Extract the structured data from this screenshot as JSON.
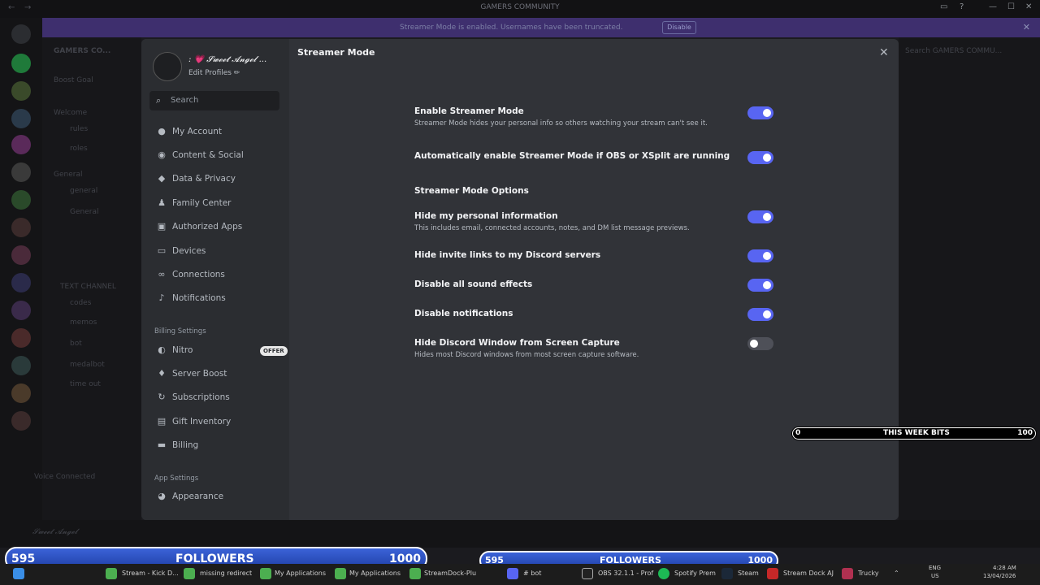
{
  "window": {
    "title": "GAMERS COMMUNITY"
  },
  "banner": {
    "message": "Streamer Mode is enabled. Usernames have been truncated.",
    "disable_label": "Disable"
  },
  "profile": {
    "name": ": 💗 𝓢𝔀𝓮𝓮𝓽 𝓐𝓷𝓰𝓮𝓵 ...",
    "edit_label": "Edit Profiles ✏"
  },
  "search": {
    "placeholder": "Search"
  },
  "sidebar": {
    "user_items": [
      {
        "label": "My Account",
        "icon": "person-icon"
      },
      {
        "label": "Content & Social",
        "icon": "content-icon"
      },
      {
        "label": "Data & Privacy",
        "icon": "shield-icon"
      },
      {
        "label": "Family Center",
        "icon": "family-icon"
      },
      {
        "label": "Authorized Apps",
        "icon": "apps-icon"
      },
      {
        "label": "Devices",
        "icon": "devices-icon"
      },
      {
        "label": "Connections",
        "icon": "link-icon"
      },
      {
        "label": "Notifications",
        "icon": "bell-icon"
      }
    ],
    "billing_header": "Billing Settings",
    "billing_items": [
      {
        "label": "Nitro",
        "icon": "nitro-icon",
        "badge": "OFFER"
      },
      {
        "label": "Server Boost",
        "icon": "boost-icon"
      },
      {
        "label": "Subscriptions",
        "icon": "refresh-icon"
      },
      {
        "label": "Gift Inventory",
        "icon": "gift-icon"
      },
      {
        "label": "Billing",
        "icon": "card-icon"
      }
    ],
    "app_header": "App Settings",
    "app_items": [
      {
        "label": "Appearance",
        "icon": "palette-icon"
      }
    ]
  },
  "content": {
    "title": "Streamer Mode",
    "enable": {
      "title": "Enable Streamer Mode",
      "desc": "Streamer Mode hides your personal info so others watching your stream can't see it.",
      "on": true
    },
    "auto": {
      "title": "Automatically enable Streamer Mode if OBS or XSplit are running",
      "on": true
    },
    "options_header": "Streamer Mode Options",
    "options": [
      {
        "title": "Hide my personal information",
        "desc": "This includes email, connected accounts, notes, and DM list message previews.",
        "on": true
      },
      {
        "title": "Hide invite links to my Discord servers",
        "desc": "",
        "on": true
      },
      {
        "title": "Disable all sound effects",
        "desc": "",
        "on": true
      },
      {
        "title": "Disable notifications",
        "desc": "",
        "on": true
      },
      {
        "title": "Hide Discord Window from Screen Capture",
        "desc": "Hides most Discord windows from most screen capture software.",
        "on": false
      }
    ]
  },
  "overlays": {
    "bits": {
      "left": "0",
      "label": "THIS WEEK BITS",
      "right": "100"
    },
    "followers_left": {
      "count": "595",
      "label": "FOLLOWERS",
      "goal": "1000",
      "fraction": 0.595
    },
    "followers_right": {
      "count": "595",
      "label": "FOLLOWERS",
      "goal": "1000",
      "fraction": 0.595
    }
  },
  "background": {
    "server_name": "GAMERS CO...",
    "boost_goal": "Boost Goal",
    "channels": [
      "Welcome",
      "rules",
      "roles",
      "General",
      "general",
      "General",
      "TEXT CHANNEL",
      "codes",
      "memos",
      "bot",
      "medalbot",
      "time out"
    ],
    "voice_connected": "Voice Connected",
    "right_search": "Search GAMERS COMMU...",
    "user_name": "𝓢𝔀𝓮𝓮𝓽 𝓐𝓷𝓰𝓮𝓵"
  },
  "taskbar": {
    "items": [
      "Stream - Kick D...",
      "missing redirect",
      "My Applications",
      "My Applications",
      "StreamDock-Plu",
      "# bot",
      "OBS 32.1.1 - Prof",
      "Spotify Prem",
      "Steam",
      "Stream Dock AJ",
      "Trucky"
    ],
    "lang": "ENG",
    "region": "US",
    "time": "4:28 AM",
    "date": "13/04/2026"
  }
}
